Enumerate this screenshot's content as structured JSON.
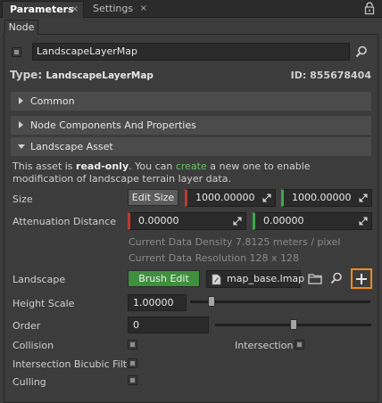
{
  "tabs": [
    {
      "label": "Parameters",
      "close": "×"
    },
    {
      "label": "Settings",
      "close": "×"
    }
  ],
  "subtab": "Node",
  "node": {
    "name": "LandscapeLayerMap",
    "type_label": "Type:",
    "type_value": "LandscapeLayerMap",
    "id_label": "ID:",
    "id_value": "855678404"
  },
  "sections": {
    "common": "Common",
    "components": "Node Components And Properties",
    "asset": "Landscape Asset"
  },
  "info": {
    "part1": "This asset is ",
    "bold": "read-only",
    "part2": ". You can ",
    "link": "create",
    "part3": " a new one to enable modification of landscape terrain layer data."
  },
  "size": {
    "label": "Size",
    "button": "Edit Size",
    "x": "1000.00000",
    "y": "1000.00000"
  },
  "attenuation": {
    "label": "Attenuation Distance",
    "x": "0.00000",
    "y": "0.00000"
  },
  "density_text": "Current Data Density 7.8125 meters / pixel",
  "resolution_text": "Current Data Resolution 128 x 128",
  "landscape": {
    "label": "Landscape",
    "button": "Brush Edit",
    "file": "map_base.lmap"
  },
  "height_scale": {
    "label": "Height Scale",
    "value": "1.00000",
    "level": 0.05
  },
  "order": {
    "label": "Order",
    "value": "0",
    "level": 0.5
  },
  "flags": {
    "collision": "Collision",
    "intersection": "Intersection",
    "bicubic": "Intersection Bicubic Filter",
    "culling": "Culling"
  }
}
